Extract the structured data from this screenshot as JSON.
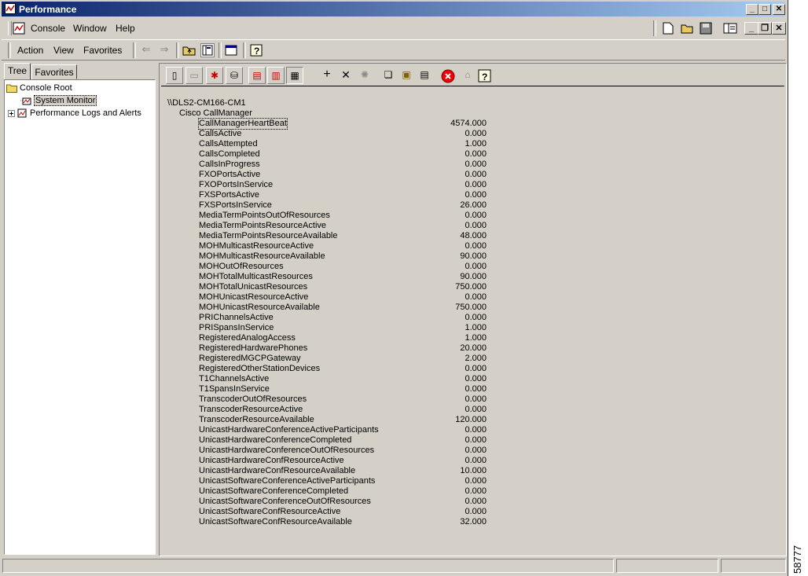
{
  "window": {
    "title": "Performance"
  },
  "menubar": {
    "items": [
      "Console",
      "Window",
      "Help"
    ]
  },
  "actionbar": {
    "items": [
      "Action",
      "View",
      "Favorites"
    ]
  },
  "tabs": [
    "Tree",
    "Favorites"
  ],
  "tree": {
    "root": "Console Root",
    "system_monitor": "System Monitor",
    "perf_logs": "Performance Logs and Alerts"
  },
  "report": {
    "computer": "\\\\DLS2-CM166-CM1",
    "object": "Cisco CallManager",
    "counters": [
      {
        "name": "CallManagerHeartBeat",
        "value": "4574.000"
      },
      {
        "name": "CallsActive",
        "value": "0.000"
      },
      {
        "name": "CallsAttempted",
        "value": "1.000"
      },
      {
        "name": "CallsCompleted",
        "value": "0.000"
      },
      {
        "name": "CallsInProgress",
        "value": "0.000"
      },
      {
        "name": "FXOPortsActive",
        "value": "0.000"
      },
      {
        "name": "FXOPortsInService",
        "value": "0.000"
      },
      {
        "name": "FXSPortsActive",
        "value": "0.000"
      },
      {
        "name": "FXSPortsInService",
        "value": "26.000"
      },
      {
        "name": "MediaTermPointsOutOfResources",
        "value": "0.000"
      },
      {
        "name": "MediaTermPointsResourceActive",
        "value": "0.000"
      },
      {
        "name": "MediaTermPointsResourceAvailable",
        "value": "48.000"
      },
      {
        "name": "MOHMulticastResourceActive",
        "value": "0.000"
      },
      {
        "name": "MOHMulticastResourceAvailable",
        "value": "90.000"
      },
      {
        "name": "MOHOutOfResources",
        "value": "0.000"
      },
      {
        "name": "MOHTotalMulticastResources",
        "value": "90.000"
      },
      {
        "name": "MOHTotalUnicastResources",
        "value": "750.000"
      },
      {
        "name": "MOHUnicastResourceActive",
        "value": "0.000"
      },
      {
        "name": "MOHUnicastResourceAvailable",
        "value": "750.000"
      },
      {
        "name": "PRIChannelsActive",
        "value": "0.000"
      },
      {
        "name": "PRISpansInService",
        "value": "1.000"
      },
      {
        "name": "RegisteredAnalogAccess",
        "value": "1.000"
      },
      {
        "name": "RegisteredHardwarePhones",
        "value": "20.000"
      },
      {
        "name": "RegisteredMGCPGateway",
        "value": "2.000"
      },
      {
        "name": "RegisteredOtherStationDevices",
        "value": "0.000"
      },
      {
        "name": "T1ChannelsActive",
        "value": "0.000"
      },
      {
        "name": "T1SpansInService",
        "value": "0.000"
      },
      {
        "name": "TranscoderOutOfResources",
        "value": "0.000"
      },
      {
        "name": "TranscoderResourceActive",
        "value": "0.000"
      },
      {
        "name": "TranscoderResourceAvailable",
        "value": "120.000"
      },
      {
        "name": "UnicastHardwareConferenceActiveParticipants",
        "value": "0.000"
      },
      {
        "name": "UnicastHardwareConferenceCompleted",
        "value": "0.000"
      },
      {
        "name": "UnicastHardwareConferenceOutOfResources",
        "value": "0.000"
      },
      {
        "name": "UnicastHardwareConfResourceActive",
        "value": "0.000"
      },
      {
        "name": "UnicastHardwareConfResourceAvailable",
        "value": "10.000"
      },
      {
        "name": "UnicastSoftwareConferenceActiveParticipants",
        "value": "0.000"
      },
      {
        "name": "UnicastSoftwareConferenceCompleted",
        "value": "0.000"
      },
      {
        "name": "UnicastSoftwareConferenceOutOfResources",
        "value": "0.000"
      },
      {
        "name": "UnicastSoftwareConfResourceActive",
        "value": "0.000"
      },
      {
        "name": "UnicastSoftwareConfResourceAvailable",
        "value": "32.000"
      }
    ]
  },
  "figure_number": "58777"
}
